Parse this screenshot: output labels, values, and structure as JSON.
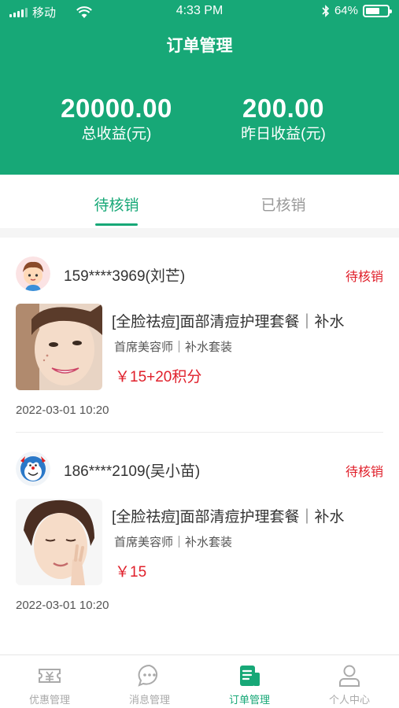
{
  "status_bar": {
    "carrier": "移动",
    "time": "4:33 PM",
    "battery": "64%",
    "battery_level": 0.64
  },
  "header": {
    "title": "订单管理",
    "total_income": {
      "value": "20000.00",
      "label": "总收益(元)"
    },
    "yesterday_income": {
      "value": "200.00",
      "label": "昨日收益(元)"
    }
  },
  "tabs": [
    {
      "label": "待核销",
      "active": true
    },
    {
      "label": "已核销",
      "active": false
    }
  ],
  "orders": [
    {
      "user": "159****3969(刘芒)",
      "status": "待核销",
      "product_title": "[全脸祛痘]面部清痘护理套餐｜补水",
      "product_sub": "首席美容师｜补水套装",
      "price": "￥15+20积分",
      "time": "2022-03-01  10:20"
    },
    {
      "user": "186****2109(吴小苗)",
      "status": "待核销",
      "product_title": "[全脸祛痘]面部清痘护理套餐｜补水",
      "product_sub": "首席美容师｜补水套装",
      "price": "￥15",
      "time": "2022-03-01  10:20"
    }
  ],
  "bottom_nav": [
    {
      "label": "优惠管理",
      "icon": "coupon-icon",
      "active": false
    },
    {
      "label": "消息管理",
      "icon": "message-icon",
      "active": false
    },
    {
      "label": "订单管理",
      "icon": "order-icon",
      "active": true
    },
    {
      "label": "个人中心",
      "icon": "user-icon",
      "active": false
    }
  ],
  "colors": {
    "primary": "#17a877",
    "accent_red": "#e0202b",
    "inactive": "#aaaaaa"
  }
}
